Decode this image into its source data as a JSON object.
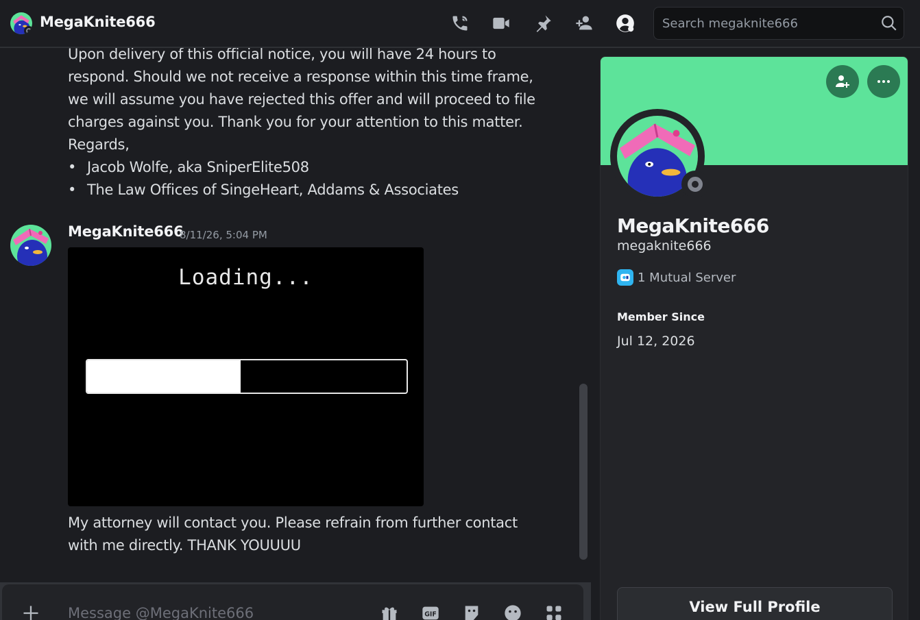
{
  "header": {
    "title": "MegaKnite666",
    "search_placeholder": "Search megaknite666"
  },
  "messages": {
    "continued_lines": [
      "Upon delivery of this official notice, you will have 24 hours to",
      "respond. Should we not receive a response within this time frame,",
      "we will assume you have rejected this offer and will proceed to file",
      "charges against you. Thank you for your attention to this matter.",
      "Regards,"
    ],
    "bullets": [
      "Jacob Wolfe, aka SniperElite508",
      "The Law Offices of SingeHeart, Addams & Associates"
    ],
    "second": {
      "author": "MegaKnite666",
      "timestamp": "8/11/26, 5:04 PM",
      "gif_text": "Loading...",
      "gif_progress_pct": 48,
      "text_lines": [
        "My attorney will contact you. Please refrain from further contact",
        "with me directly. THANK YOUUUU"
      ]
    }
  },
  "composer": {
    "placeholder": "Message @MegaKnite666"
  },
  "profile": {
    "display_name": "MegaKnite666",
    "username": "megaknite666",
    "mutual_servers": "1 Mutual Server",
    "member_since_label": "Member Since",
    "member_since_date": "Jul 12, 2026",
    "view_full_profile": "View Full Profile"
  },
  "colors": {
    "banner": "#5de39a",
    "background": "#1c1d21",
    "accent_button": "#2b7a53"
  },
  "icons": [
    "phone-call-icon",
    "video-call-icon",
    "pin-icon",
    "add-friend-icon",
    "user-profile-icon",
    "search-icon",
    "plus-icon",
    "gift-icon",
    "gif-icon",
    "sticker-icon",
    "emoji-icon",
    "apps-icon",
    "more-icon"
  ]
}
